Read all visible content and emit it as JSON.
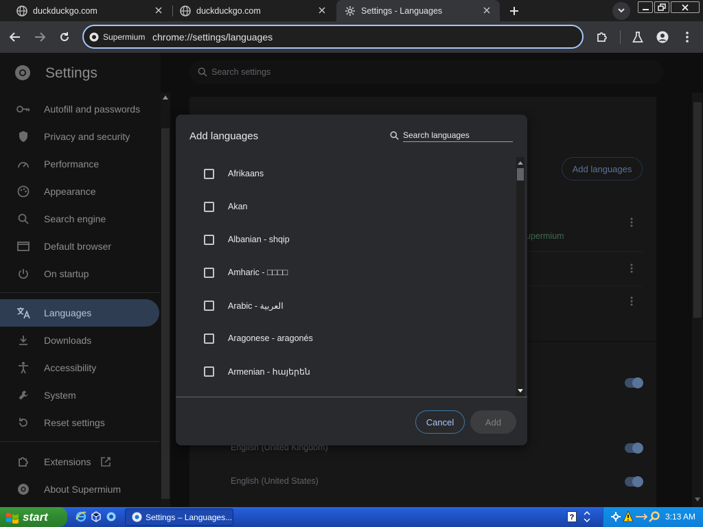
{
  "browser": {
    "tabs": [
      {
        "title": "duckduckgo.com",
        "active": false
      },
      {
        "title": "duckduckgo.com",
        "active": false
      },
      {
        "title": "Settings - Languages",
        "active": true
      }
    ],
    "omnibox": {
      "chip_label": "Supermium",
      "url": "chrome://settings/languages"
    }
  },
  "settings": {
    "title": "Settings",
    "search_placeholder": "Search settings",
    "nav": [
      {
        "label": "Autofill and passwords",
        "icon": "key-icon"
      },
      {
        "label": "Privacy and security",
        "icon": "shield-icon"
      },
      {
        "label": "Performance",
        "icon": "gauge-icon"
      },
      {
        "label": "Appearance",
        "icon": "palette-icon"
      },
      {
        "label": "Search engine",
        "icon": "search-icon"
      },
      {
        "label": "Default browser",
        "icon": "browser-window-icon"
      },
      {
        "label": "On startup",
        "icon": "power-icon"
      },
      {
        "label": "Languages",
        "icon": "translate-icon",
        "active": true
      },
      {
        "label": "Downloads",
        "icon": "download-icon"
      },
      {
        "label": "Accessibility",
        "icon": "accessibility-icon"
      },
      {
        "label": "System",
        "icon": "wrench-icon"
      },
      {
        "label": "Reset settings",
        "icon": "reset-icon"
      }
    ],
    "extensions_label": "Extensions",
    "about_label": "About Supermium",
    "background": {
      "add_languages_label": "Add languages",
      "supermium_hint": "upermium",
      "lang_uk": "English (United Kingdom)",
      "lang_us": "English (United States)"
    }
  },
  "dialog": {
    "title": "Add languages",
    "search_value": "Search languages",
    "languages": [
      "Afrikaans",
      "Akan",
      "Albanian - shqip",
      "Amharic - □□□□",
      "Arabic - العربية",
      "Aragonese - aragonés",
      "Armenian - հայերեն"
    ],
    "cancel_label": "Cancel",
    "add_label": "Add"
  },
  "taskbar": {
    "start_label": "start",
    "task_label": "Settings – Languages...",
    "clock": "3:13 AM"
  },
  "colors": {
    "accent": "#a8c7fa",
    "active_nav": "#2f3d52",
    "taskbar": "#245edb",
    "start": "#2f8a2f"
  }
}
